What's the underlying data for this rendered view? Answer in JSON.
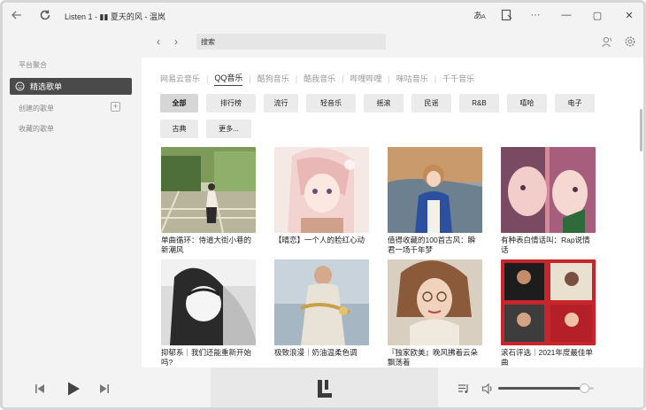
{
  "window": {
    "title": "Listen 1 - ▮▮ 夏天的风 - 温岚",
    "controls": {
      "minimize": "—",
      "maximize": "▢",
      "close": "✕",
      "more": "···"
    }
  },
  "sidebar": {
    "section_platform": "平台聚合",
    "selected_item": "精选歌单",
    "section_created": "创建的歌单",
    "section_favorites": "收藏的歌单",
    "add_symbol": "+"
  },
  "topbar": {
    "search_value": "搜索",
    "back_symbol": "‹",
    "forward_symbol": "›"
  },
  "source_tabs": [
    {
      "label": "网易云音乐",
      "active": false
    },
    {
      "label": "QQ音乐",
      "active": true
    },
    {
      "label": "酷狗音乐",
      "active": false
    },
    {
      "label": "酷我音乐",
      "active": false
    },
    {
      "label": "哔哩哔哩",
      "active": false
    },
    {
      "label": "咪咕音乐",
      "active": false
    },
    {
      "label": "千千音乐",
      "active": false
    }
  ],
  "categories": [
    {
      "label": "全部",
      "active": true
    },
    {
      "label": "排行榜",
      "active": false
    },
    {
      "label": "流行",
      "active": false
    },
    {
      "label": "轻音乐",
      "active": false
    },
    {
      "label": "摇滚",
      "active": false
    },
    {
      "label": "民谣",
      "active": false
    },
    {
      "label": "R&B",
      "active": false
    },
    {
      "label": "嘻哈",
      "active": false
    },
    {
      "label": "电子",
      "active": false
    },
    {
      "label": "古典",
      "active": false
    },
    {
      "label": "更多...",
      "active": false
    }
  ],
  "playlists": [
    {
      "title": "单曲循环：侍道大街小巷的新潮风"
    },
    {
      "title": "【晴恋】一个人的脸红心动"
    },
    {
      "title": "值得收藏的100首古风：瞬君一场千年梦"
    },
    {
      "title": "有种表白情话叫：Rap说情话"
    },
    {
      "title": "抑郁系｜我们还能重新开始吗?"
    },
    {
      "title": "极致浪漫｜奶油温柔色调"
    },
    {
      "title": "『独家欧美』晚风拂着云朵飘荡着"
    },
    {
      "title": "滚石评选｜2021年度最佳单曲"
    }
  ],
  "player": {
    "volume_fraction": 0.9
  },
  "colors": {
    "accent": "#4a4a4a",
    "sidebar_bg": "#f3f3f3",
    "chip_bg": "#ebebeb"
  }
}
